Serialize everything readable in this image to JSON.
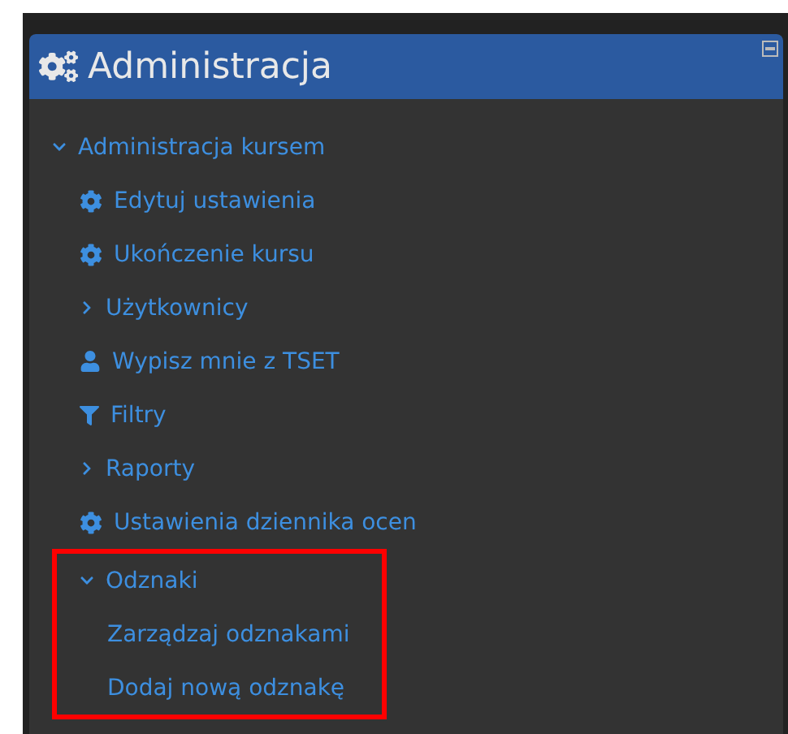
{
  "block": {
    "title": "Administracja",
    "tree": [
      {
        "label": "Administracja kursem",
        "kind": "folder",
        "expanded": true,
        "highlighted": false,
        "children": [
          {
            "label": "Edytuj ustawienia",
            "kind": "gear"
          },
          {
            "label": "Ukończenie kursu",
            "kind": "gear"
          },
          {
            "label": "Użytkownicy",
            "kind": "folder",
            "expanded": false,
            "highlighted": false
          },
          {
            "label": "Wypisz mnie z TSET",
            "kind": "user"
          },
          {
            "label": "Filtry",
            "kind": "filter"
          },
          {
            "label": "Raporty",
            "kind": "folder",
            "expanded": false,
            "highlighted": false
          },
          {
            "label": "Ustawienia dziennika ocen",
            "kind": "gear"
          },
          {
            "label": "Odznaki",
            "kind": "folder",
            "expanded": true,
            "highlighted": true,
            "children": [
              {
                "label": "Zarządzaj odznakami"
              },
              {
                "label": "Dodaj nową odznakę"
              }
            ]
          }
        ]
      }
    ]
  }
}
